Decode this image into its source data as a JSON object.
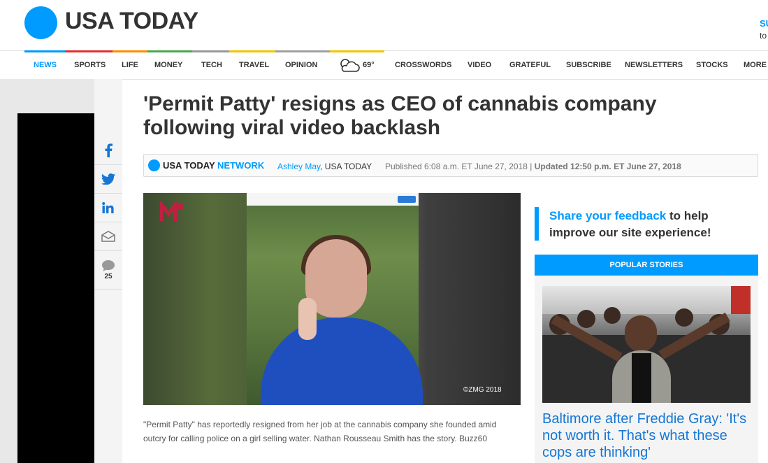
{
  "brand": {
    "logo_text": "USA TODAY",
    "accent": "#009bff",
    "subscribe_peek": "SU",
    "subscribe_peek_2": "to"
  },
  "nav": {
    "items": [
      {
        "label": "NEWS",
        "active": true
      },
      {
        "label": "SPORTS"
      },
      {
        "label": "LIFE"
      },
      {
        "label": "MONEY"
      },
      {
        "label": "TECH"
      },
      {
        "label": "TRAVEL"
      },
      {
        "label": "OPINION"
      },
      {
        "label": "CROSSWORDS"
      },
      {
        "label": "VIDEO"
      },
      {
        "label": "GRATEFUL"
      },
      {
        "label": "SUBSCRIBE"
      },
      {
        "label": "NEWSLETTERS"
      },
      {
        "label": "STOCKS"
      },
      {
        "label": "MORE"
      }
    ],
    "weather_icon": "partly-cloudy-icon",
    "weather_temp": "69°"
  },
  "share": {
    "facebook_icon": "facebook-icon",
    "twitter_icon": "twitter-icon",
    "linkedin_icon": "linkedin-icon",
    "email_icon": "email-icon",
    "comment_icon": "comment-icon",
    "comment_count": "25"
  },
  "article": {
    "headline": "'Permit Patty' resigns as CEO of cannabis company following viral video backlash",
    "byline_brand": "USA TODAY",
    "byline_network": "NETWORK",
    "author_name": "Ashley May",
    "author_outlet": ", USA TODAY",
    "published": "Published 6:08 a.m. ET June 27, 2018 | ",
    "updated": "Updated 12:50 p.m. ET June 27, 2018",
    "video_credit": "©ZMG 2018",
    "caption": "\"Permit Patty\" has reportedly resigned from her job at the cannabis company she founded amid outcry for calling police on a girl selling water. Nathan Rousseau Smith has the story. Buzz60"
  },
  "rail": {
    "feedback_link": "Share your feedback",
    "feedback_rest": " to help improve our site experience!",
    "popular_header": "POPULAR STORIES",
    "popular_title": "Baltimore after Freddie Gray: 'It's not worth it. That's what these cops are thinking'"
  }
}
